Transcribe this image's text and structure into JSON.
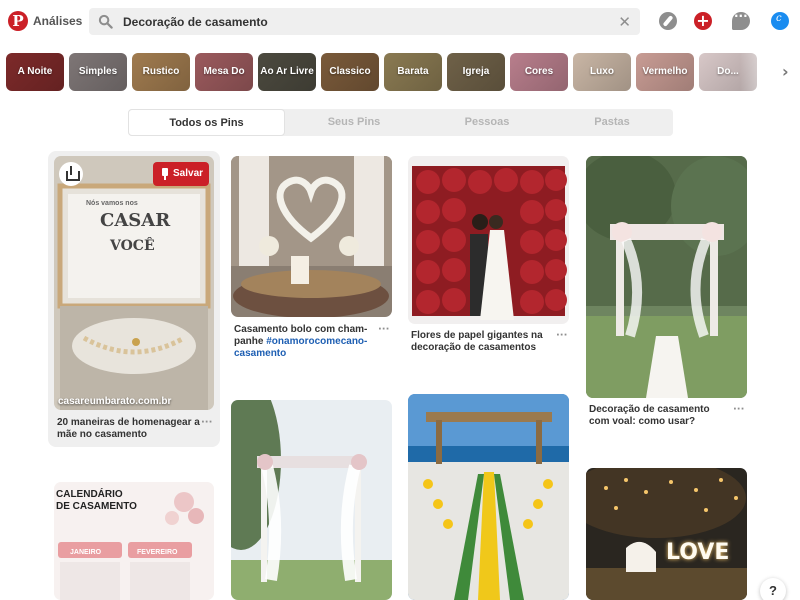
{
  "header": {
    "brand": "Análises",
    "search_value": "Decoração de casamento",
    "clear_glyph": "✕",
    "plus_glyph": "+",
    "icons": [
      "pinterest-logo",
      "compass-icon",
      "plus-icon",
      "chat-icon",
      "avatar"
    ]
  },
  "categories": [
    {
      "label": "A Noite",
      "color": "#7d2a2a"
    },
    {
      "label": "Simples",
      "color": "#7e7676"
    },
    {
      "label": "Rustico",
      "color": "#a07b4f"
    },
    {
      "label": "Mesa Do Bolo",
      "color": "#9b5a5d"
    },
    {
      "label": "Ao Ar Livre",
      "color": "#4c4a3f"
    },
    {
      "label": "Classico",
      "color": "#7a5a3a"
    },
    {
      "label": "Barata",
      "color": "#8a7a52"
    },
    {
      "label": "Igreja",
      "color": "#6f6148"
    },
    {
      "label": "Cores",
      "color": "#b87e8c"
    },
    {
      "label": "Luxo",
      "color": "#c9b6a5"
    },
    {
      "label": "Vermelho",
      "color": "#c89c94"
    },
    {
      "label": "Do...",
      "color": "#d8c8c8"
    }
  ],
  "tabs": [
    {
      "label": "Todos os Pins",
      "active": true
    },
    {
      "label": "Seus Pins",
      "active": false
    },
    {
      "label": "Pessoas",
      "active": false
    },
    {
      "label": "Pastas",
      "active": false
    }
  ],
  "pins": {
    "p1": {
      "title_line1": "20 maneiras de homenagear a",
      "title_line2": "mãe no casamento",
      "save_label": "Salvar",
      "source": "casareumbarato.com.br",
      "card_heading": "CASAR",
      "card_top": "Nós vamos nos",
      "card_you": "VOCÊ",
      "color": "#d8d4cc"
    },
    "p2": {
      "title_line1": "Casamento bolo com cham-",
      "title_line2": "panhe ",
      "tag_line2": "#onamorocomecano-",
      "tag_line3": "casamento",
      "color": "#bfb6ad"
    },
    "p3": {
      "title_line1": "Flores de papel gigantes na",
      "title_line2": "decoração de casamentos",
      "color": "#9f1f25"
    },
    "p4": {
      "title_line1": "Decoração de casamento",
      "title_line2": "com voal: como usar?",
      "color": "#8aa08a"
    },
    "p5": {
      "heading_line1": "CALENDÁRIO",
      "heading_line2": "DE CASAMENTO",
      "month1": "JANEIRO",
      "month2": "FEVEREIRO",
      "color": "#f6efee"
    },
    "p6": {
      "color": "#9fb8a0"
    },
    "p7": {
      "color": "#2f6da6"
    },
    "p8": {
      "text": "LOVE",
      "color": "#2a2a2a"
    }
  },
  "more_glyph": "···",
  "help_label": "?"
}
